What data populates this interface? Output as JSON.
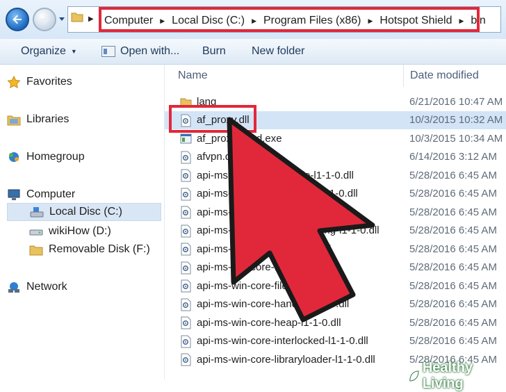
{
  "breadcrumb": [
    "Computer",
    "Local Disc (C:)",
    "Program Files (x86)",
    "Hotspot Shield",
    "bin"
  ],
  "toolbar": {
    "organize": "Organize",
    "open_with": "Open with...",
    "burn": "Burn",
    "new_folder": "New folder"
  },
  "sidebar": {
    "favorites": "Favorites",
    "libraries": "Libraries",
    "homegroup": "Homegroup",
    "computer": "Computer",
    "local_disc": "Local Disc (C:)",
    "wikihow": "wikiHow (D:)",
    "removable": "Removable Disk (F:)",
    "network": "Network"
  },
  "columns": {
    "name": "Name",
    "date": "Date modified"
  },
  "files": [
    {
      "name": "lang",
      "date": "6/21/2016 10:47 AM",
      "type": "folder"
    },
    {
      "name": "af_proxy.dll",
      "date": "10/3/2015 10:32 AM",
      "type": "dll"
    },
    {
      "name": "af_proxy_cmd.exe",
      "date": "10/3/2015 10:34 AM",
      "type": "exe"
    },
    {
      "name": "afvpn.dll",
      "date": "6/14/2016 3:12 AM",
      "type": "dll"
    },
    {
      "name": "api-ms-win-core-console-l1-1-0.dll",
      "date": "5/28/2016 6:45 AM",
      "type": "dll"
    },
    {
      "name": "api-ms-win-core-datetime-l1-1-0.dll",
      "date": "5/28/2016 6:45 AM",
      "type": "dll"
    },
    {
      "name": "api-ms-win-core-debug-l1-1-0.dll",
      "date": "5/28/2016 6:45 AM",
      "type": "dll"
    },
    {
      "name": "api-ms-win-core-errorhandling-l1-1-0.dll",
      "date": "5/28/2016 6:45 AM",
      "type": "dll"
    },
    {
      "name": "api-ms-win-core-file-l1-1-0.dll",
      "date": "5/28/2016 6:45 AM",
      "type": "dll"
    },
    {
      "name": "api-ms-win-core-file-l1-2-0.dll",
      "date": "5/28/2016 6:45 AM",
      "type": "dll"
    },
    {
      "name": "api-ms-win-core-file-l2-1-0.dll",
      "date": "5/28/2016 6:45 AM",
      "type": "dll"
    },
    {
      "name": "api-ms-win-core-handle-l1-1-0.dll",
      "date": "5/28/2016 6:45 AM",
      "type": "dll"
    },
    {
      "name": "api-ms-win-core-heap-l1-1-0.dll",
      "date": "5/28/2016 6:45 AM",
      "type": "dll"
    },
    {
      "name": "api-ms-win-core-interlocked-l1-1-0.dll",
      "date": "5/28/2016 6:45 AM",
      "type": "dll"
    },
    {
      "name": "api-ms-win-core-libraryloader-l1-1-0.dll",
      "date": "5/28/2016 6:45 AM",
      "type": "dll"
    }
  ],
  "selected_index": 1,
  "watermark": "Healthy Living",
  "colors": {
    "highlight": "#e1283a",
    "selection": "#d3e4f7",
    "arrow": "#e1283a"
  }
}
